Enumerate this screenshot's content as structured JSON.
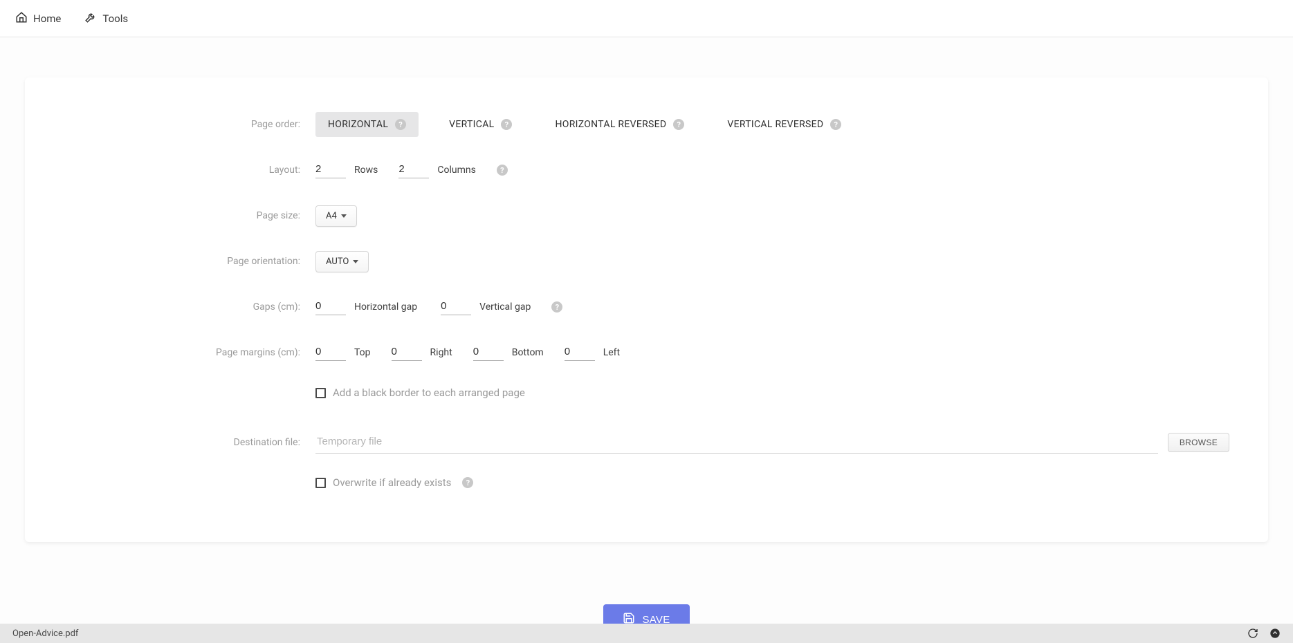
{
  "nav": {
    "home": "Home",
    "tools": "Tools"
  },
  "labels": {
    "page_order": "Page order:",
    "layout": "Layout:",
    "page_size": "Page size:",
    "page_orientation": "Page orientation:",
    "gaps": "Gaps (cm):",
    "page_margins": "Page margins (cm):",
    "destination_file": "Destination file:"
  },
  "page_order": {
    "options": [
      "HORIZONTAL",
      "VERTICAL",
      "HORIZONTAL REVERSED",
      "VERTICAL REVERSED"
    ],
    "selected": "HORIZONTAL"
  },
  "layout": {
    "rows_value": "2",
    "rows_label": "Rows",
    "cols_value": "2",
    "cols_label": "Columns"
  },
  "page_size": {
    "value": "A4"
  },
  "page_orientation": {
    "value": "AUTO"
  },
  "gaps": {
    "h_value": "0",
    "h_label": "Horizontal gap",
    "v_value": "0",
    "v_label": "Vertical gap"
  },
  "margins": {
    "top_value": "0",
    "top_label": "Top",
    "right_value": "0",
    "right_label": "Right",
    "bottom_value": "0",
    "bottom_label": "Bottom",
    "left_value": "0",
    "left_label": "Left"
  },
  "border_checkbox": "Add a black border to each arranged page",
  "destination": {
    "placeholder": "Temporary file",
    "value": "",
    "browse": "BROWSE"
  },
  "overwrite_checkbox": "Overwrite if already exists",
  "save_button": "SAVE",
  "footer": {
    "filename": "Open-Advice.pdf"
  }
}
